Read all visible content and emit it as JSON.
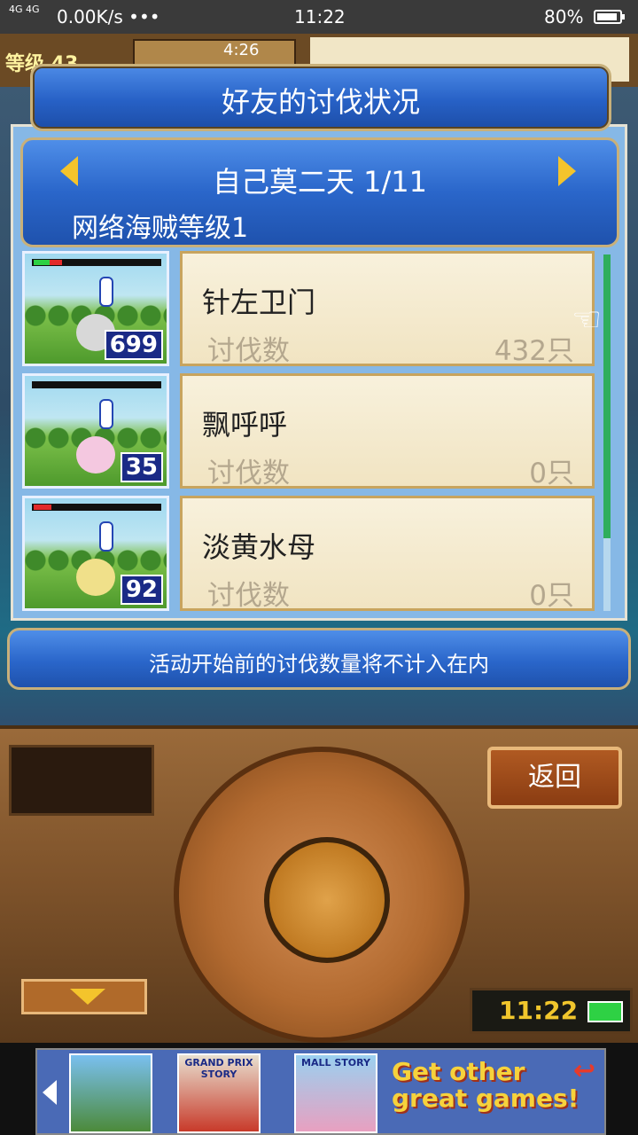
{
  "status_bar": {
    "network": "4G 4G",
    "speed": "0.00K/s •••",
    "time": "11:22",
    "battery": "80%"
  },
  "game_hud": {
    "level_label": "等级 43",
    "clock": "4:26"
  },
  "dialog": {
    "title": "好友的讨伐状况",
    "friend_name": "自己莫二天 1/11",
    "pirate_level": "网络海贼等级1",
    "kill_label": "讨伐数",
    "monsters": [
      {
        "name": "针左卫门",
        "kills": "432只",
        "count": "699",
        "hp_green": 0.13,
        "hp_red": 0.1,
        "color": "#d8d8d8"
      },
      {
        "name": "飘呼呼",
        "kills": "0只",
        "count": "35",
        "hp_green": 0,
        "hp_red": 0,
        "color": "#f4c8e0"
      },
      {
        "name": "淡黄水母",
        "kills": "0只",
        "count": "92",
        "hp_green": 0,
        "hp_red": 0.14,
        "color": "#f0e08a"
      }
    ],
    "notice": "活动开始前的讨伐数量将不计入在内"
  },
  "controller": {
    "back_label": "返回",
    "clock": "11:22"
  },
  "ad": {
    "game2_label": "GRAND PRIX STORY",
    "game3_label": "MALL STORY",
    "cta": "Get other great games!"
  }
}
